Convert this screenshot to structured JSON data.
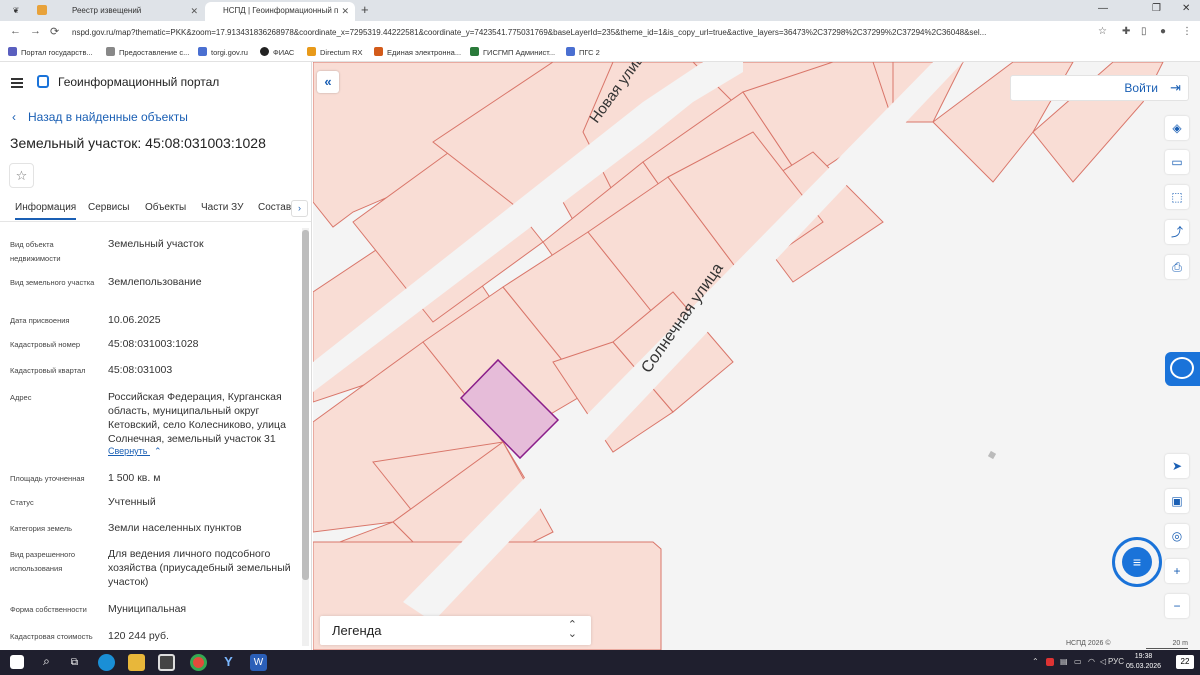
{
  "browser": {
    "tabs": [
      {
        "label": "Реестр извещений"
      },
      {
        "label": "НСПД | Геоинформационный п"
      }
    ],
    "url": "nspd.gov.ru/map?thematic=PKK&zoom=17.913431836268978&coordinate_x=7295319.44222581&coordinate_y=7423541.775031769&baseLayerId=235&theme_id=1&is_copy_url=true&active_layers=36473%2C37298%2C37299%2C37294%2C36048&sel...",
    "bookmarks": [
      {
        "label": "Портал государств...",
        "color": "#5a5fbf"
      },
      {
        "label": "Предоставление с...",
        "color": "#888"
      },
      {
        "label": "torgi.gov.ru",
        "color": "#4a6fd1"
      },
      {
        "label": "ФИАС",
        "color": "#222"
      },
      {
        "label": "Directum RX",
        "color": "#e89a1a"
      },
      {
        "label": "Единая электронна...",
        "color": "#d35b1a"
      },
      {
        "label": "ГИСГМП Админист...",
        "color": "#2a7a3a"
      },
      {
        "label": "ПГС 2",
        "color": "#4a6fd1"
      }
    ]
  },
  "sidebar": {
    "portal_title": "Геоинформационный портал",
    "back_label": "Назад в найденные объекты",
    "object_title": "Земельный участок: 45:08:031003:1028",
    "tabs": [
      "Информация",
      "Сервисы",
      "Объекты",
      "Части ЗУ",
      "Состав"
    ],
    "active_tab": "Информация",
    "fields": [
      {
        "label": "Вид объекта недвижимости",
        "value": "Земельный участок"
      },
      {
        "label": "Вид земельного участка",
        "value": "Землепользование"
      },
      {
        "label": "Дата присвоения",
        "value": "10.06.2025"
      },
      {
        "label": "Кадастровый номер",
        "value": "45:08:031003:1028"
      },
      {
        "label": "Кадастровый квартал",
        "value": "45:08:031003"
      },
      {
        "label": "Адрес",
        "value": "Российская Федерация, Курганская область, муниципальный округ Кетовский, село Колесниково, улица Солнечная, земельный участок 31"
      },
      {
        "label": "Площадь уточненная",
        "value": "1 500 кв. м"
      },
      {
        "label": "Статус",
        "value": "Учтенный"
      },
      {
        "label": "Категория земель",
        "value": "Земли населенных пунктов"
      },
      {
        "label": "Вид разрешенного использования",
        "value": "Для ведения личного подсобного хозяйства (приусадебный земельный участок)"
      },
      {
        "label": "Форма собственности",
        "value": "Муниципальная"
      },
      {
        "label": "Кадастровая стоимость",
        "value": "120 244 руб."
      }
    ],
    "collapse_label": "Свернуть"
  },
  "map": {
    "street_1": "Новая улица",
    "street_2": "Солнечная улица",
    "login_label": "Войти",
    "legend_label": "Легенда",
    "copyright": "НСПД 2026 ©",
    "scale_label": "20 m",
    "colors": {
      "parcel_fill": "#f9ddd5",
      "parcel_stroke": "#d9766a",
      "selected_fill": "#e6bcd9",
      "selected_stroke": "#8a1e8a",
      "accent": "#1a73d9"
    }
  },
  "taskbar": {
    "time": "19:38",
    "date": "05.03.2026",
    "lang": "РУС",
    "badge": "22"
  }
}
